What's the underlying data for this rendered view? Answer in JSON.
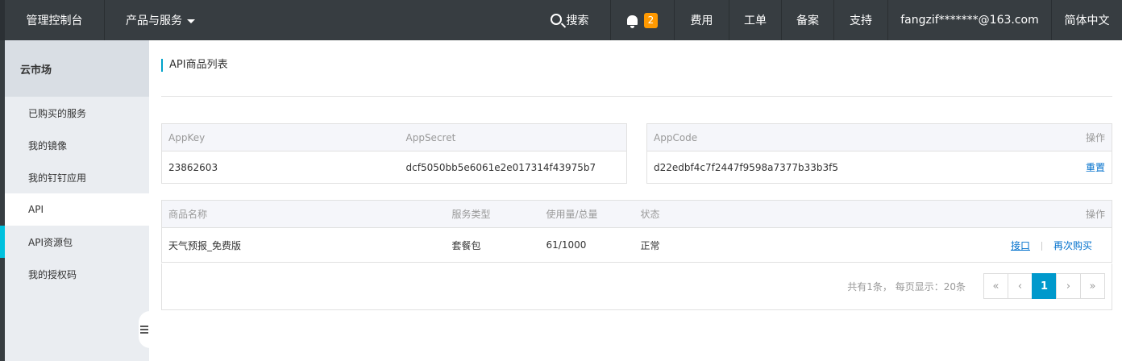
{
  "topbar": {
    "console": "管理控制台",
    "products": "产品与服务",
    "search": "搜索",
    "notification_count": "2",
    "fee": "费用",
    "ticket": "工单",
    "record": "备案",
    "support": "支持",
    "user": "fangzif*******@163.com",
    "language": "简体中文"
  },
  "sidebar": {
    "title": "云市场",
    "items": [
      {
        "label": "已购买的服务"
      },
      {
        "label": "我的镜像"
      },
      {
        "label": "我的钉钉应用"
      },
      {
        "label": "API"
      },
      {
        "label": "API资源包"
      },
      {
        "label": "我的授权码"
      }
    ]
  },
  "page": {
    "title": "API商品列表"
  },
  "keys_table": {
    "headers": {
      "appkey": "AppKey",
      "appsecret": "AppSecret"
    },
    "row": {
      "appkey": "23862603",
      "appsecret": "dcf5050bb5e6061e2e017314f43975b7"
    }
  },
  "code_table": {
    "headers": {
      "appcode": "AppCode",
      "op": "操作"
    },
    "row": {
      "appcode": "d22edbf4c7f2447f9598a7377b33b3f5",
      "reset": "重置"
    }
  },
  "goods_table": {
    "headers": {
      "name": "商品名称",
      "type": "服务类型",
      "usage": "使用量/总量",
      "status": "状态",
      "op": "操作"
    },
    "rows": [
      {
        "name": "天气预报_免费版",
        "type": "套餐包",
        "usage": "61/1000",
        "status": "正常",
        "api": "接口",
        "rebuy": "再次购买"
      }
    ]
  },
  "pagination": {
    "summary": "共有1条， 每页显示：20条",
    "first": "«",
    "prev": "‹",
    "current": "1",
    "next": "›",
    "last": "»"
  }
}
